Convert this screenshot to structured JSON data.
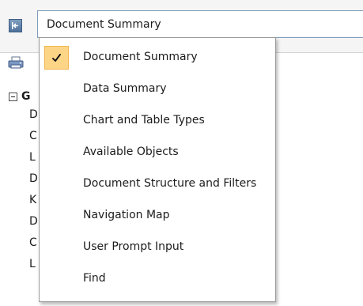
{
  "header": {
    "collapse_icon": "collapse-left-icon",
    "selector_value": "Document Summary"
  },
  "toolbar": {
    "print_icon": "print-icon"
  },
  "tree": {
    "group_label": "G",
    "items": [
      "D",
      "C",
      "L",
      "D",
      "K",
      "D",
      "C",
      "L"
    ]
  },
  "menu": {
    "checked_icon": "check-icon",
    "items": [
      {
        "label": "Document Summary",
        "checked": true
      },
      {
        "label": "Data Summary",
        "checked": false
      },
      {
        "label": "Chart and Table Types",
        "checked": false
      },
      {
        "label": "Available Objects",
        "checked": false
      },
      {
        "label": "Document Structure and Filters",
        "checked": false
      },
      {
        "label": "Navigation Map",
        "checked": false
      },
      {
        "label": "User Prompt Input",
        "checked": false
      },
      {
        "label": "Find",
        "checked": false
      }
    ]
  },
  "colors": {
    "highlight": "#fdd587",
    "highlight_border": "#f0b650",
    "field_border": "#7f9db9",
    "button_blue": "#4e719c"
  }
}
